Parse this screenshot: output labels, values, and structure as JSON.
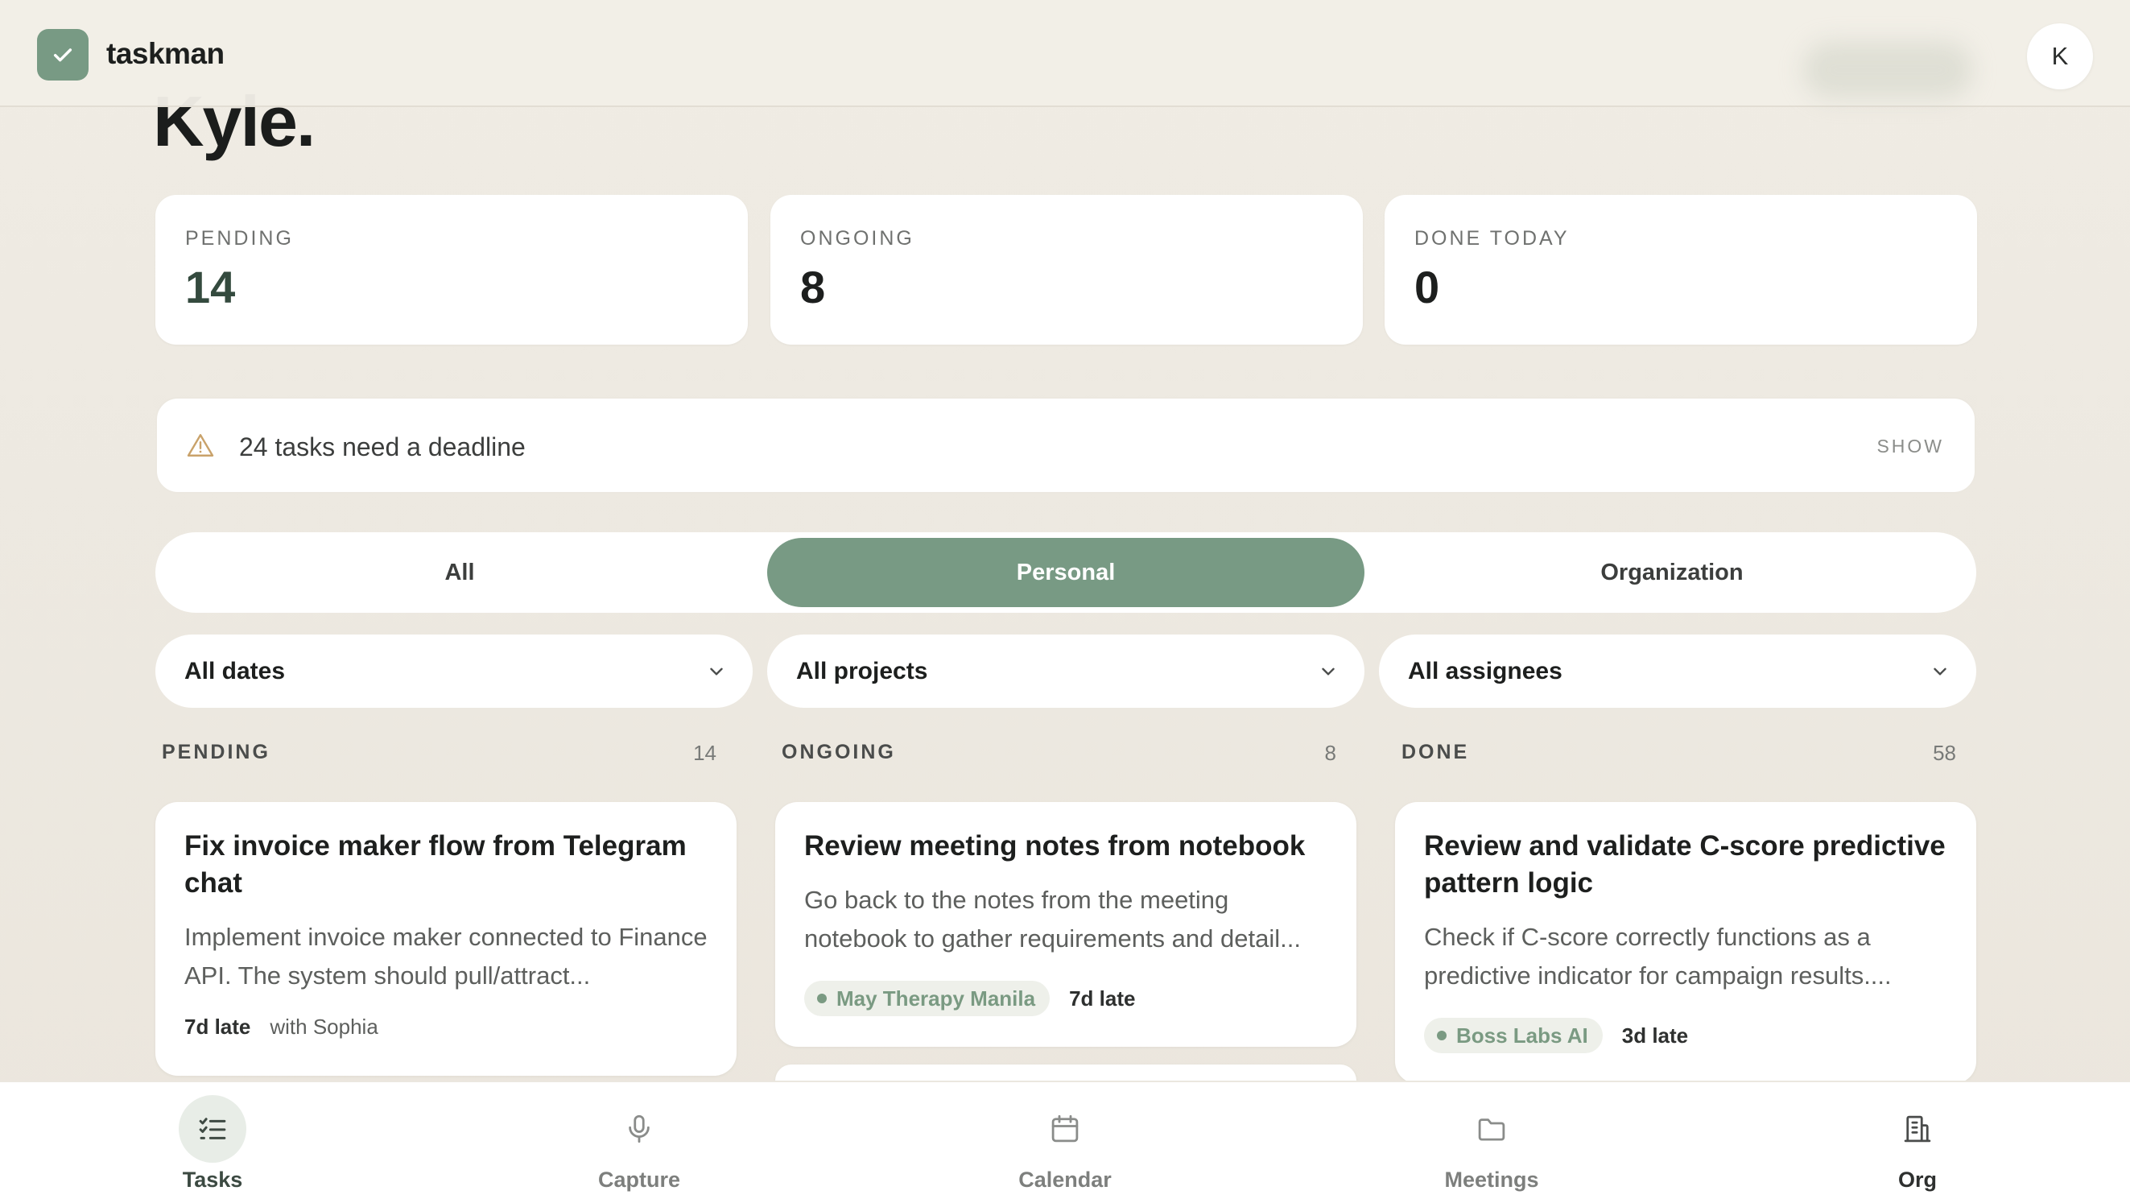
{
  "app": {
    "name": "taskman",
    "avatar_initial": "K"
  },
  "greeting": "Kyle.",
  "stats": [
    {
      "label": "PENDING",
      "value": "14"
    },
    {
      "label": "ONGOING",
      "value": "8"
    },
    {
      "label": "DONE TODAY",
      "value": "0"
    }
  ],
  "banner": {
    "text": "24 tasks need a deadline",
    "action": "SHOW",
    "icon": "warning-triangle-icon"
  },
  "scope_tabs": [
    {
      "label": "All",
      "active": false
    },
    {
      "label": "Personal",
      "active": true
    },
    {
      "label": "Organization",
      "active": false
    }
  ],
  "filters": [
    {
      "label": "All dates"
    },
    {
      "label": "All projects"
    },
    {
      "label": "All assignees"
    }
  ],
  "columns": [
    {
      "title": "PENDING",
      "count": "14",
      "cards": [
        {
          "title": "Fix invoice maker flow from Telegram chat",
          "description": "Implement invoice maker connected to Finance API. The system should pull/attract...",
          "late": "7d late",
          "with": "with Sophia"
        }
      ]
    },
    {
      "title": "ONGOING",
      "count": "8",
      "cards": [
        {
          "title": "Review meeting notes from notebook",
          "description": "Go back to the notes from the meeting notebook to gather requirements and detail...",
          "tag": "May Therapy Manila",
          "late": "7d late"
        }
      ]
    },
    {
      "title": "DONE",
      "count": "58",
      "cards": [
        {
          "title": "Review and validate C-score predictive pattern logic",
          "description": "Check if C-score correctly functions as a predictive indicator for campaign results....",
          "tag": "Boss Labs AI",
          "late": "3d late"
        }
      ]
    }
  ],
  "bottom_nav": [
    {
      "label": "Tasks",
      "icon": "tasks-list-icon",
      "active": true
    },
    {
      "label": "Capture",
      "icon": "microphone-icon",
      "active": false
    },
    {
      "label": "Calendar",
      "icon": "calendar-icon",
      "active": false
    },
    {
      "label": "Meetings",
      "icon": "folder-icon",
      "active": false
    },
    {
      "label": "Org",
      "icon": "building-icon",
      "active": false
    }
  ],
  "colors": {
    "accent": "#789a84",
    "background": "#eeeae2",
    "card": "#ffffff"
  }
}
